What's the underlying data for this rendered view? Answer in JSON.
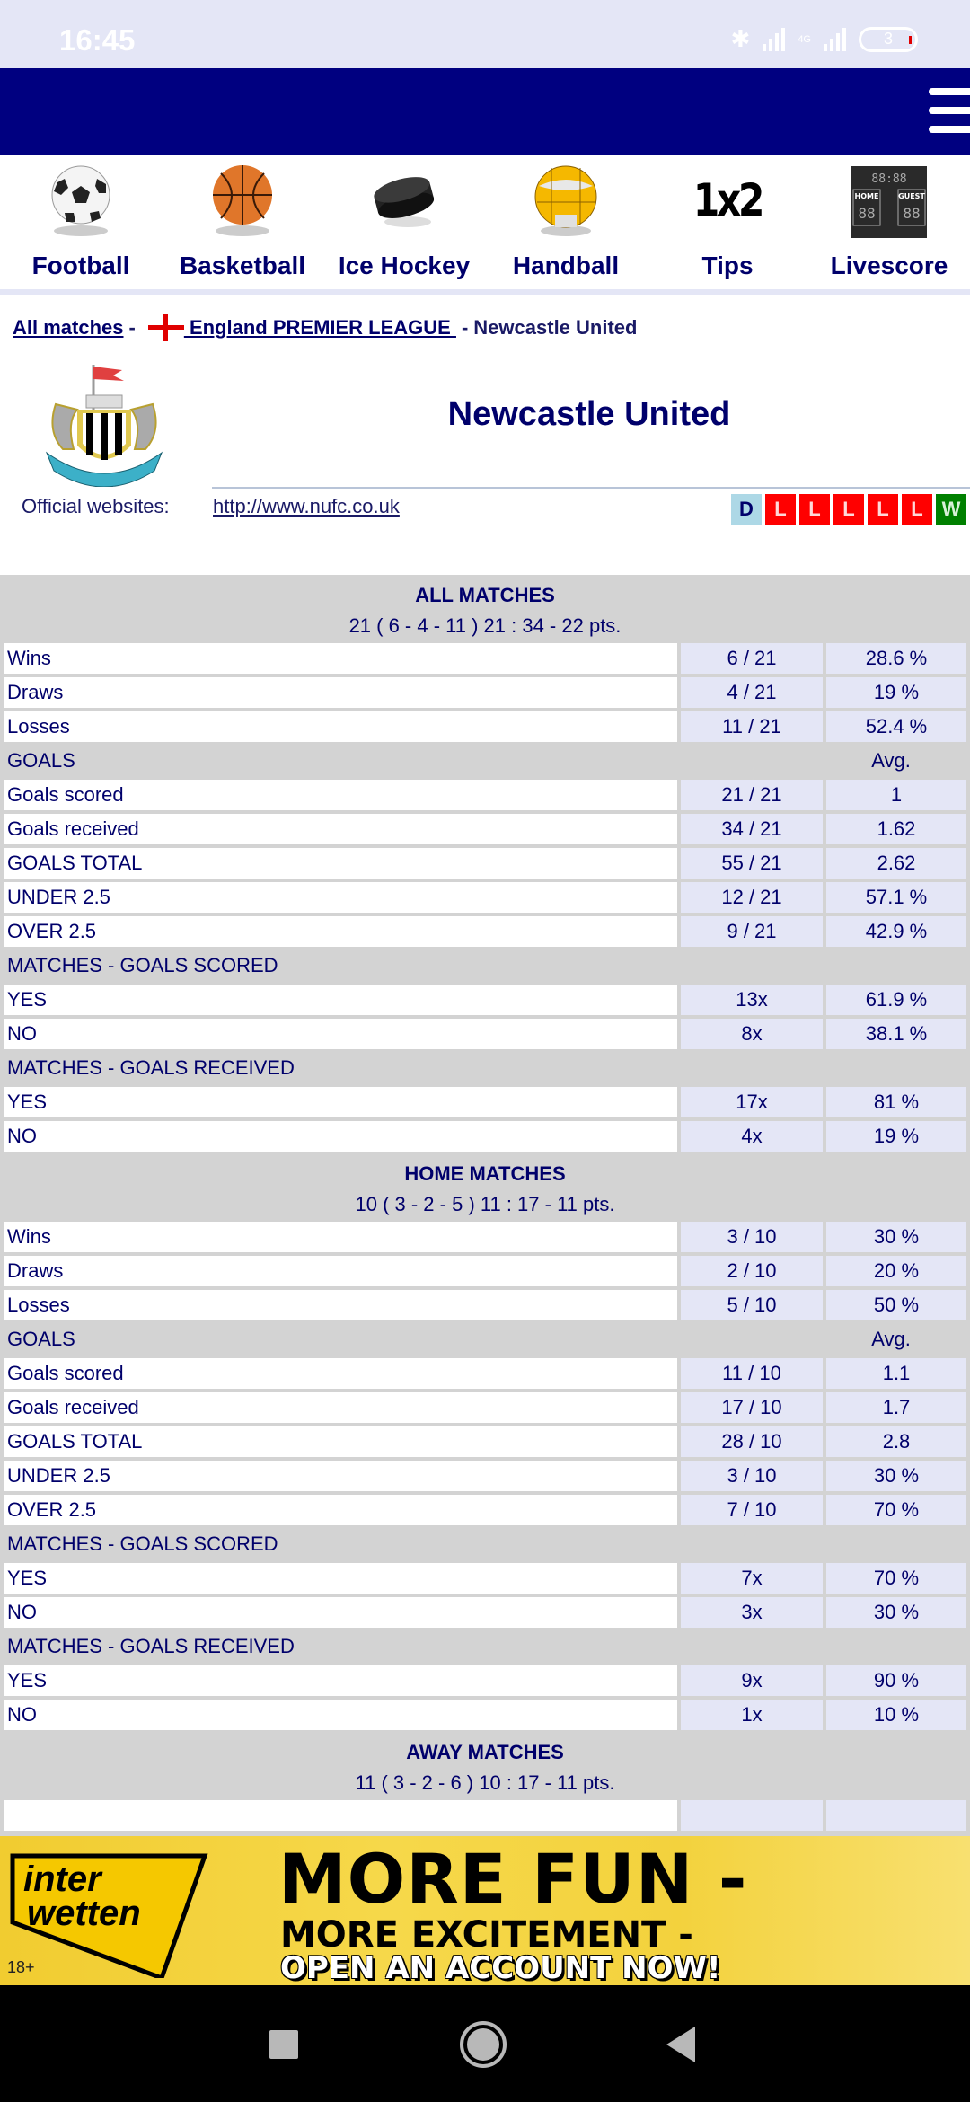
{
  "status_bar": {
    "time": "16:45",
    "network": "4G",
    "battery": "3"
  },
  "nav": {
    "sports": [
      {
        "label": "Football",
        "icon": "soccer-ball-icon"
      },
      {
        "label": "Basketball",
        "icon": "basketball-icon"
      },
      {
        "label": "Ice Hockey",
        "icon": "hockey-puck-icon"
      },
      {
        "label": "Handball",
        "icon": "handball-icon"
      },
      {
        "label": "Tips",
        "icon": "1x2-tips-icon",
        "glyph": "1x2"
      },
      {
        "label": "Livescore",
        "icon": "scoreboard-icon"
      }
    ]
  },
  "breadcrumb": {
    "all_matches": "All matches",
    "sep": "-",
    "league": " England PREMIER LEAGUE ",
    "team": "Newcastle United"
  },
  "team": {
    "name": "Newcastle United",
    "official_label": "Official websites:",
    "website": "http://www.nufc.co.uk",
    "form": [
      "D",
      "L",
      "L",
      "L",
      "L",
      "L",
      "W"
    ],
    "form_colors": {
      "D": "#add8e6",
      "L": "#ff0000",
      "W": "#008000"
    }
  },
  "stats": {
    "avg_label": "Avg.",
    "sections": [
      {
        "title": "ALL MATCHES",
        "summary": "21 ( 6 - 4 - 11 ) 21 : 34 - 22 pts.",
        "results": [
          {
            "label": "Wins",
            "count": "6 / 21",
            "pct": "28.6 %"
          },
          {
            "label": "Draws",
            "count": "4 / 21",
            "pct": "19 %"
          },
          {
            "label": "Losses",
            "count": "11 / 21",
            "pct": "52.4 %"
          }
        ],
        "goals_title": "GOALS",
        "goals": [
          {
            "label": "Goals scored",
            "count": "21 / 21",
            "val": "1"
          },
          {
            "label": "Goals received",
            "count": "34 / 21",
            "val": "1.62"
          },
          {
            "label": "GOALS TOTAL",
            "count": "55 / 21",
            "val": "2.62"
          },
          {
            "label": "UNDER 2.5",
            "count": "12 / 21",
            "val": "57.1 %"
          },
          {
            "label": "OVER 2.5",
            "count": "9 / 21",
            "val": "42.9 %"
          }
        ],
        "scored_title": "MATCHES - GOALS SCORED",
        "scored": [
          {
            "label": "YES",
            "count": "13x",
            "pct": "61.9 %"
          },
          {
            "label": "NO",
            "count": "8x",
            "pct": "38.1 %"
          }
        ],
        "received_title": "MATCHES - GOALS RECEIVED",
        "received": [
          {
            "label": "YES",
            "count": "17x",
            "pct": "81 %"
          },
          {
            "label": "NO",
            "count": "4x",
            "pct": "19 %"
          }
        ]
      },
      {
        "title": "HOME MATCHES",
        "summary": "10 ( 3 - 2 - 5 ) 11 : 17 - 11 pts.",
        "results": [
          {
            "label": "Wins",
            "count": "3 / 10",
            "pct": "30 %"
          },
          {
            "label": "Draws",
            "count": "2 / 10",
            "pct": "20 %"
          },
          {
            "label": "Losses",
            "count": "5 / 10",
            "pct": "50 %"
          }
        ],
        "goals_title": "GOALS",
        "goals": [
          {
            "label": "Goals scored",
            "count": "11 / 10",
            "val": "1.1"
          },
          {
            "label": "Goals received",
            "count": "17 / 10",
            "val": "1.7"
          },
          {
            "label": "GOALS TOTAL",
            "count": "28 / 10",
            "val": "2.8"
          },
          {
            "label": "UNDER 2.5",
            "count": "3 / 10",
            "val": "30 %"
          },
          {
            "label": "OVER 2.5",
            "count": "7 / 10",
            "val": "70 %"
          }
        ],
        "scored_title": "MATCHES - GOALS SCORED",
        "scored": [
          {
            "label": "YES",
            "count": "7x",
            "pct": "70 %"
          },
          {
            "label": "NO",
            "count": "3x",
            "pct": "30 %"
          }
        ],
        "received_title": "MATCHES - GOALS RECEIVED",
        "received": [
          {
            "label": "YES",
            "count": "9x",
            "pct": "90 %"
          },
          {
            "label": "NO",
            "count": "1x",
            "pct": "10 %"
          }
        ]
      },
      {
        "title": "AWAY MATCHES",
        "summary": "11 ( 3 - 2 - 6 ) 10 : 17 - 11 pts."
      }
    ]
  },
  "ad": {
    "brand_line1": "inter",
    "brand_line2": "wetten",
    "age": "18+",
    "headline1": "MORE FUN -",
    "headline2": "MORE EXCITEMENT -",
    "headline3": "OPEN AN ACCOUNT NOW!",
    "accent": "#f3d23d"
  }
}
